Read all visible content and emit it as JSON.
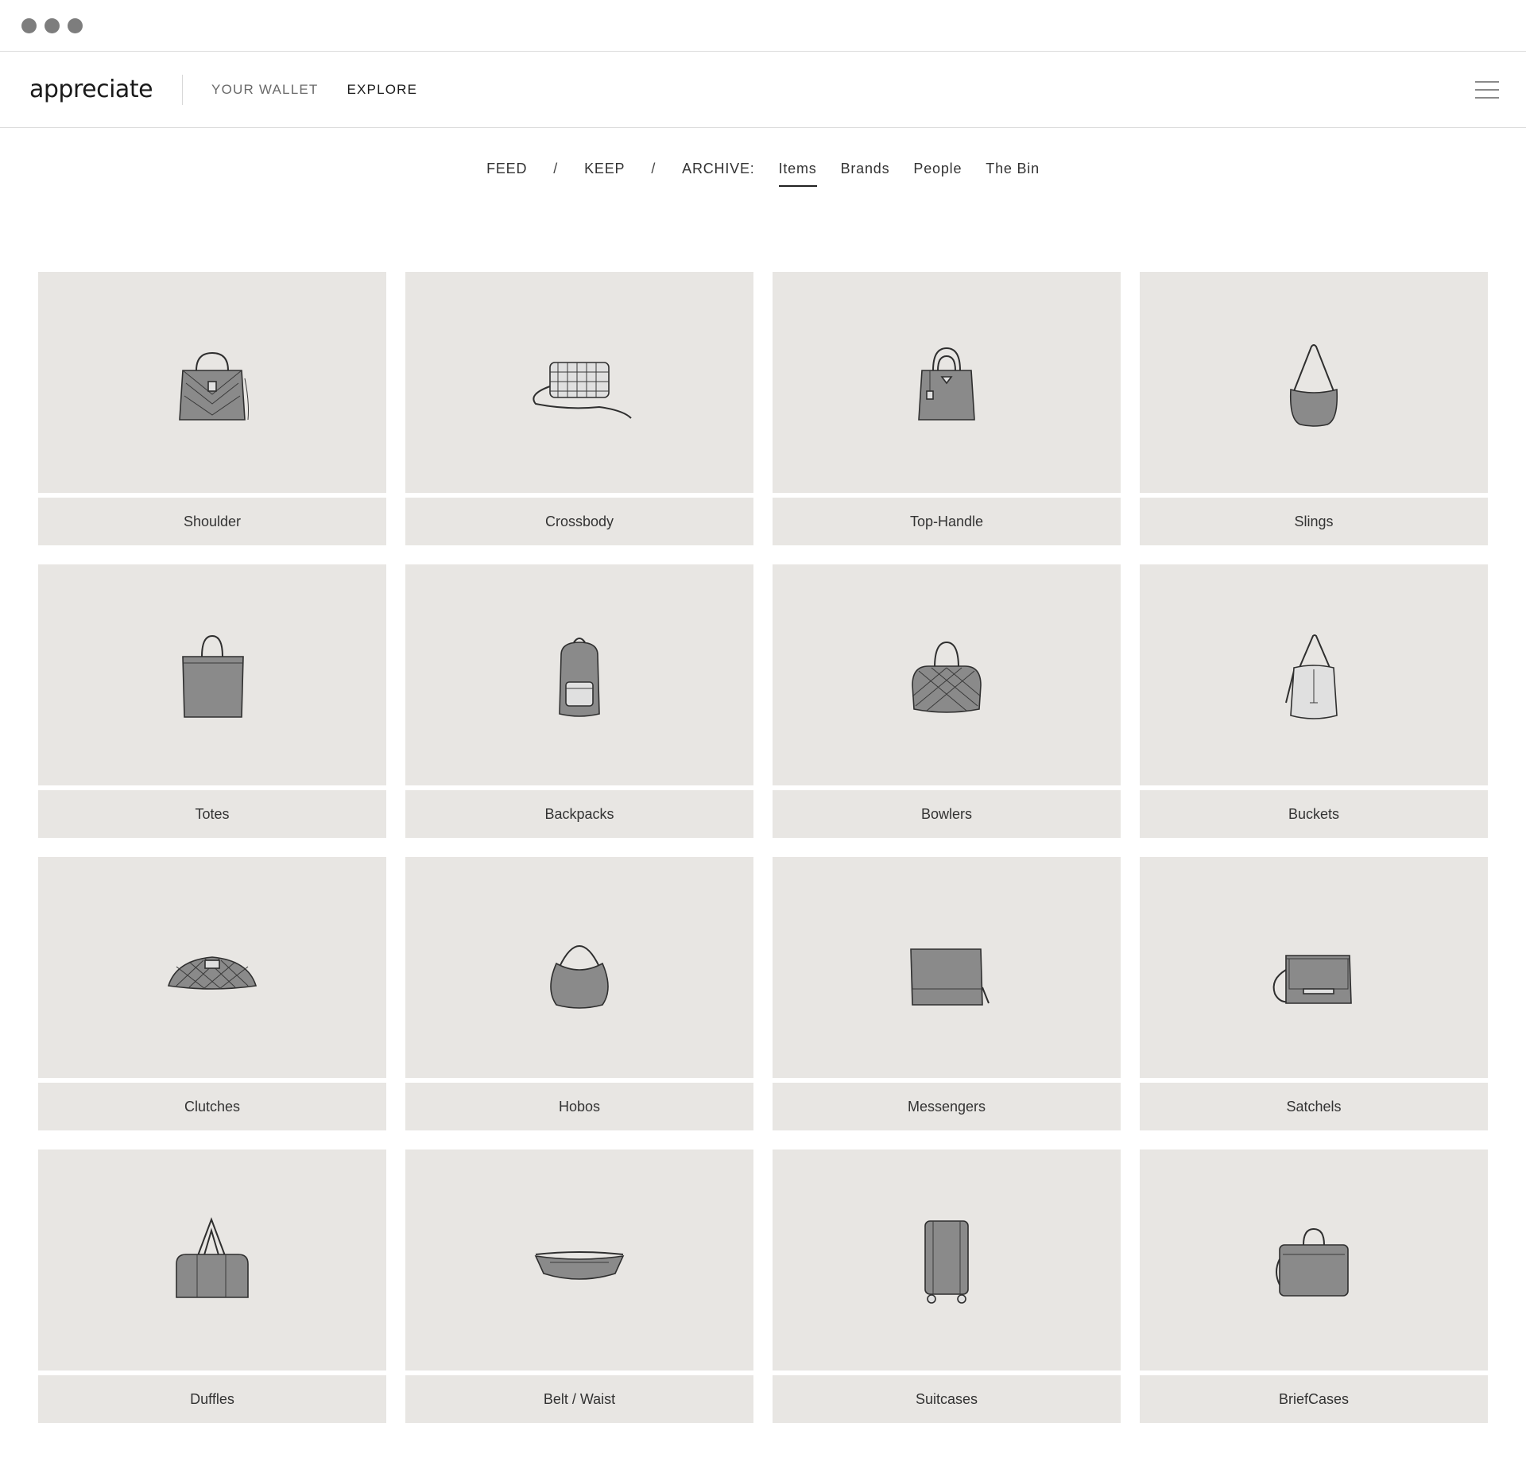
{
  "window": {
    "controls": [
      "window-dot",
      "window-dot",
      "window-dot"
    ]
  },
  "header": {
    "logo": "appreciate",
    "nav": [
      {
        "label": "YOUR WALLET",
        "active": false
      },
      {
        "label": "EXPLORE",
        "active": true
      }
    ],
    "menu_icon": "hamburger-menu-icon"
  },
  "subnav": {
    "feed": "FEED",
    "keep": "KEEP",
    "archive": "ARCHIVE:",
    "separator": "/",
    "tabs": [
      {
        "label": "Items",
        "active": true
      },
      {
        "label": "Brands",
        "active": false
      },
      {
        "label": "People",
        "active": false
      },
      {
        "label": "The Bin",
        "active": false
      }
    ]
  },
  "categories": [
    {
      "label": "Shoulder",
      "icon": "shoulder-bag-icon"
    },
    {
      "label": "Crossbody",
      "icon": "crossbody-bag-icon"
    },
    {
      "label": "Top-Handle",
      "icon": "top-handle-bag-icon"
    },
    {
      "label": "Slings",
      "icon": "sling-bag-icon"
    },
    {
      "label": "Totes",
      "icon": "tote-bag-icon"
    },
    {
      "label": "Backpacks",
      "icon": "backpack-icon"
    },
    {
      "label": "Bowlers",
      "icon": "bowler-bag-icon"
    },
    {
      "label": "Buckets",
      "icon": "bucket-bag-icon"
    },
    {
      "label": "Clutches",
      "icon": "clutch-bag-icon"
    },
    {
      "label": "Hobos",
      "icon": "hobo-bag-icon"
    },
    {
      "label": "Messengers",
      "icon": "messenger-bag-icon"
    },
    {
      "label": "Satchels",
      "icon": "satchel-bag-icon"
    },
    {
      "label": "Duffles",
      "icon": "duffle-bag-icon"
    },
    {
      "label": "Belt / Waist",
      "icon": "belt-bag-icon"
    },
    {
      "label": "Suitcases",
      "icon": "suitcase-icon"
    },
    {
      "label": "BriefCases",
      "icon": "briefcase-icon"
    }
  ],
  "colors": {
    "card_bg": "#e8e6e3",
    "bag_fill": "#8a8a8a",
    "bag_stroke": "#2f2f2f"
  }
}
